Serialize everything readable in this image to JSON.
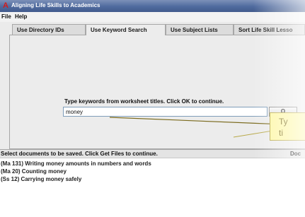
{
  "window": {
    "title": "Aligning Life Skills to Academics"
  },
  "menu": [
    "File",
    "Help"
  ],
  "tabs": [
    {
      "label": "Use Directory IDs",
      "active": false
    },
    {
      "label": "Use Keyword Search",
      "active": true
    },
    {
      "label": "Use Subject Lists",
      "active": false
    },
    {
      "label": "Sort Life Skill Lesso",
      "active": false
    }
  ],
  "keyword": {
    "label": "Type keywords from worksheet titles. Click OK to continue.",
    "value": "money",
    "button": "O"
  },
  "callout": {
    "line1": "Ty",
    "line2": "ti"
  },
  "status": {
    "text": "Select documents to be saved. Click Get Files to continue.",
    "right": "Doc"
  },
  "documents": [
    "(Ma 131)  Writing money amounts in numbers and words",
    "(Ma 20)  Counting money",
    "(Ss 12)  Carrying money safely"
  ],
  "colors": {
    "titlebar": "#4f6a9e",
    "callout": "#fdf7a6",
    "app_icon": "#d21c1c"
  }
}
